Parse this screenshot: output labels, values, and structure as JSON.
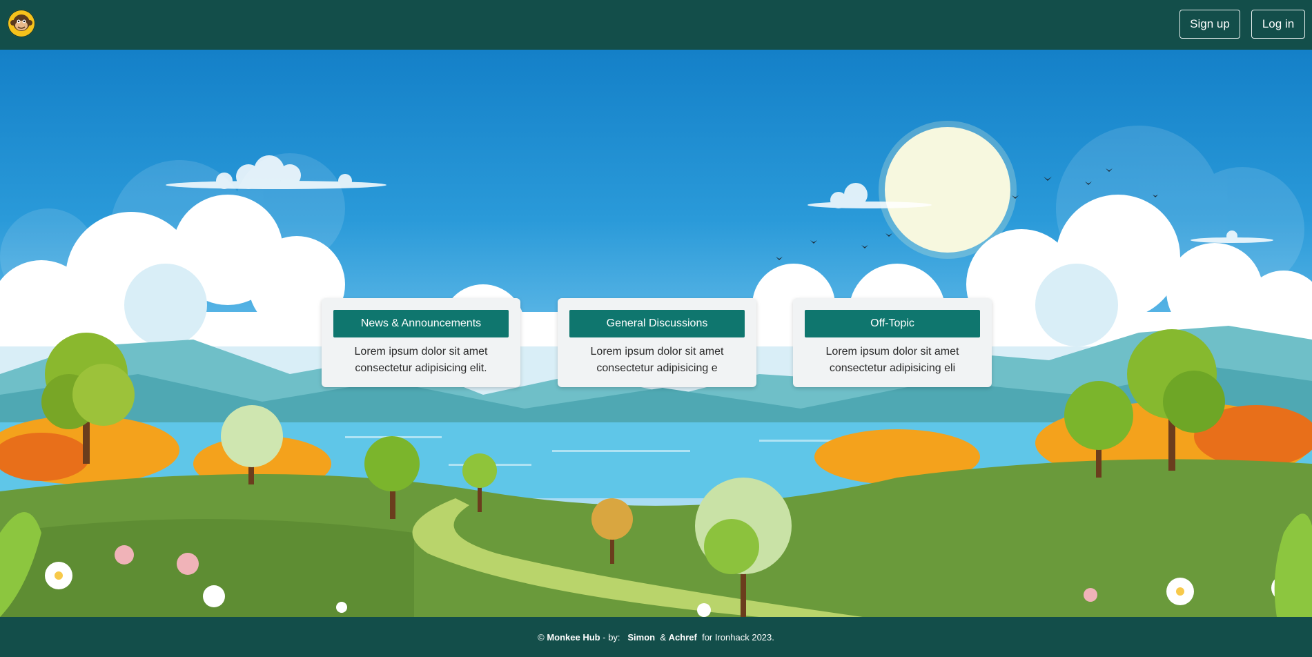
{
  "header": {
    "logo_icon": "monkey-logo-icon",
    "signup_label": "Sign up",
    "login_label": "Log in"
  },
  "cards": [
    {
      "title": "News & Announcements",
      "text": "Lorem ipsum dolor sit amet consectetur adipisicing elit."
    },
    {
      "title": "General Discussions",
      "text": "Lorem ipsum dolor sit amet consectetur adipisicing e"
    },
    {
      "title": "Off-Topic",
      "text": "Lorem ipsum dolor sit amet consectetur adipisicing eli"
    }
  ],
  "footer": {
    "copyright": "©",
    "brand": "Monkee Hub",
    "by": "- by:",
    "author1": "Simon",
    "amp": "&",
    "author2": "Achref",
    "suffix": "for Ironhack 2023."
  },
  "colors": {
    "navbar": "#134e4a",
    "card_button": "#0f766e",
    "card_bg": "#f1f3f4"
  }
}
